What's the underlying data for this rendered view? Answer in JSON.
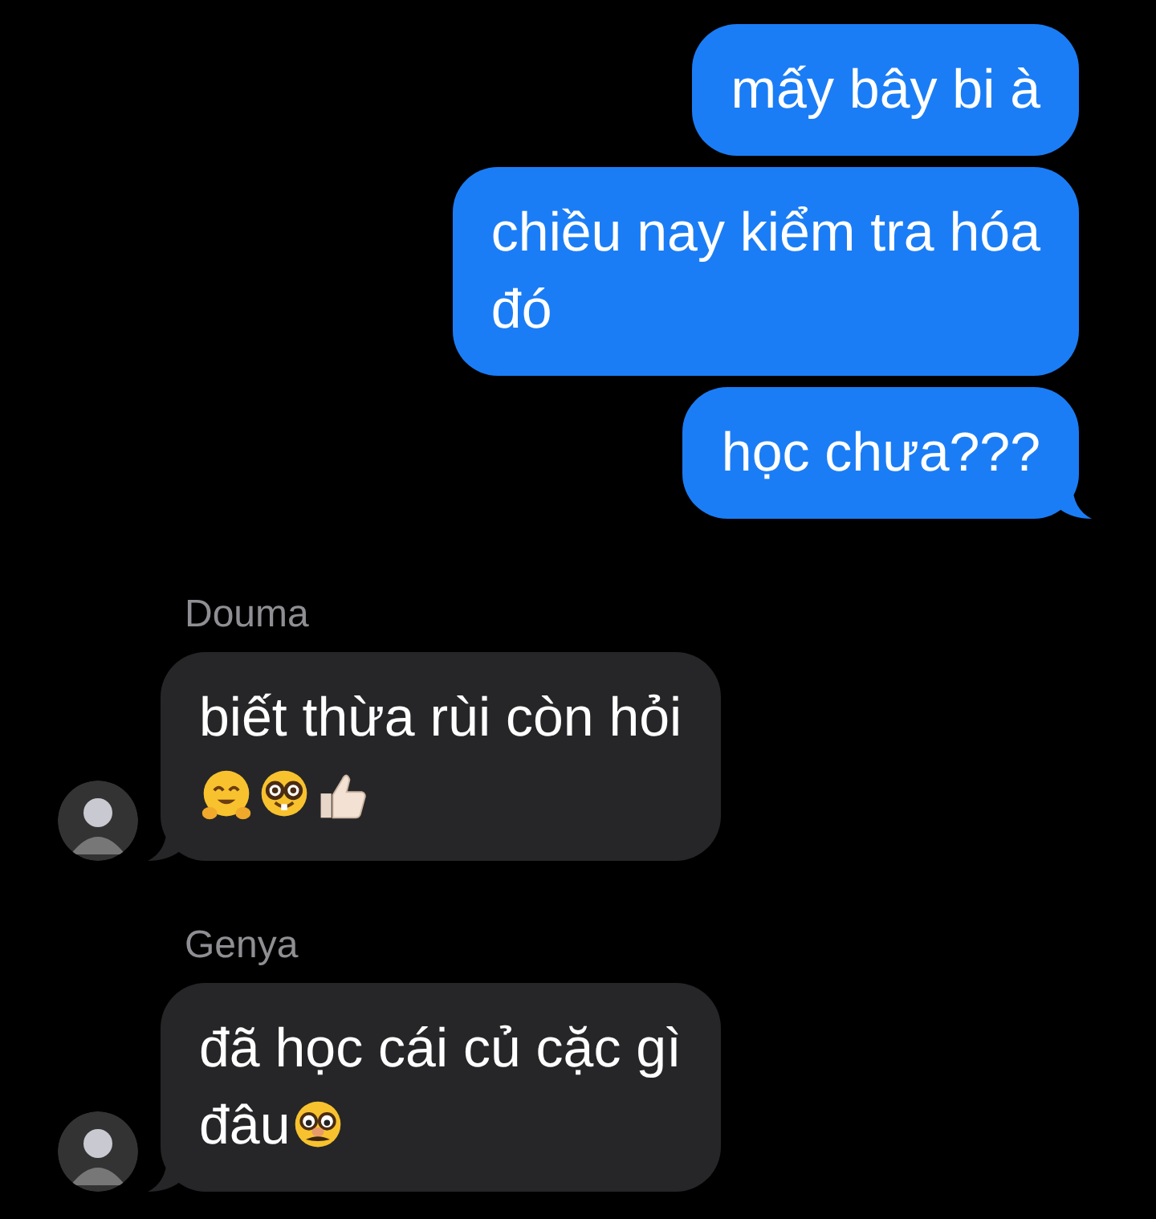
{
  "messages": [
    {
      "kind": "outgoing",
      "tail": false,
      "lines": [
        {
          "text": "mấy bây bi à"
        }
      ]
    },
    {
      "kind": "outgoing",
      "tail": false,
      "lines": [
        {
          "text": "chiều nay kiểm tra hóa"
        },
        {
          "text": "đó"
        }
      ]
    },
    {
      "kind": "outgoing",
      "tail": true,
      "lines": [
        {
          "text": "học chưa???"
        }
      ]
    },
    {
      "kind": "incoming",
      "sender": "Douma",
      "tail": true,
      "lines": [
        {
          "text": "biết thừa rùi còn hỏi"
        },
        {
          "emoji": [
            {
              "kind": "hugging"
            },
            {
              "kind": "nerd"
            },
            {
              "kind": "thumbs-up"
            }
          ]
        }
      ]
    },
    {
      "kind": "incoming",
      "sender": "Genya",
      "tail": true,
      "lines": [
        {
          "text": "đã học cái củ cặc gì"
        },
        {
          "text": "đâu",
          "emoji": [
            {
              "kind": "disguise"
            }
          ]
        }
      ]
    }
  ]
}
